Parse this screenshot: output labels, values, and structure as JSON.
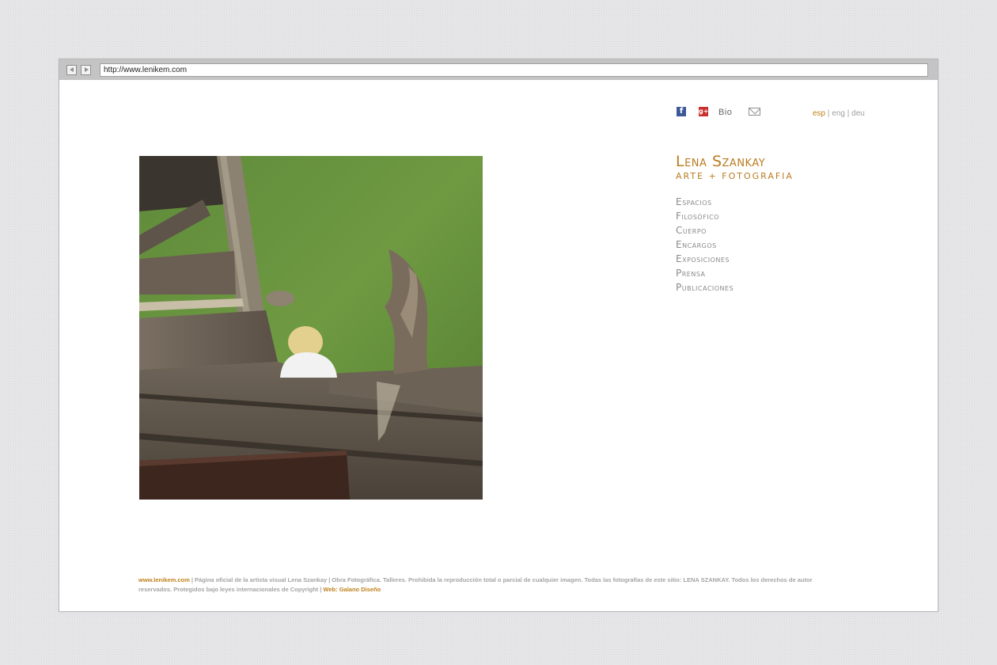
{
  "browser": {
    "url": "http://www.lenikem.com"
  },
  "topbar": {
    "facebook_icon": "facebook-icon",
    "googleplus_icon": "google-plus-icon",
    "bio_label": "Bio",
    "mail_icon": "mail-icon",
    "languages": [
      "esp",
      "eng",
      "deu"
    ],
    "active_language": "esp"
  },
  "brand": {
    "name": "Lena Szankay",
    "tagline": "ARTE + FOTOGRAFIA"
  },
  "menu": {
    "items": [
      {
        "label": "Espacios"
      },
      {
        "label": "Filosófico"
      },
      {
        "label": "Cuerpo"
      },
      {
        "label": "Encargos"
      },
      {
        "label": "Exposiciones"
      },
      {
        "label": "Prensa"
      },
      {
        "label": "Publicaciones"
      }
    ]
  },
  "footer": {
    "site_link": "www.lenikem.com",
    "text": " | Página oficial de la artista visual Lena Szankay | Obra Fotográfica. Talleres. Prohibida la reproducción total o parcial de cualquier imagen. Todas las fotografías de este sitio: LENA SZANKAY. Todos los derechos de autor reservados. Protegidos bajo leyes internacionales de Copyright  |  ",
    "design_credit": "Web: Galano Diseño"
  },
  "colors": {
    "accent": "#c0811b",
    "menu_text": "#8a8a8a",
    "page_background": "#e6e6e8"
  }
}
